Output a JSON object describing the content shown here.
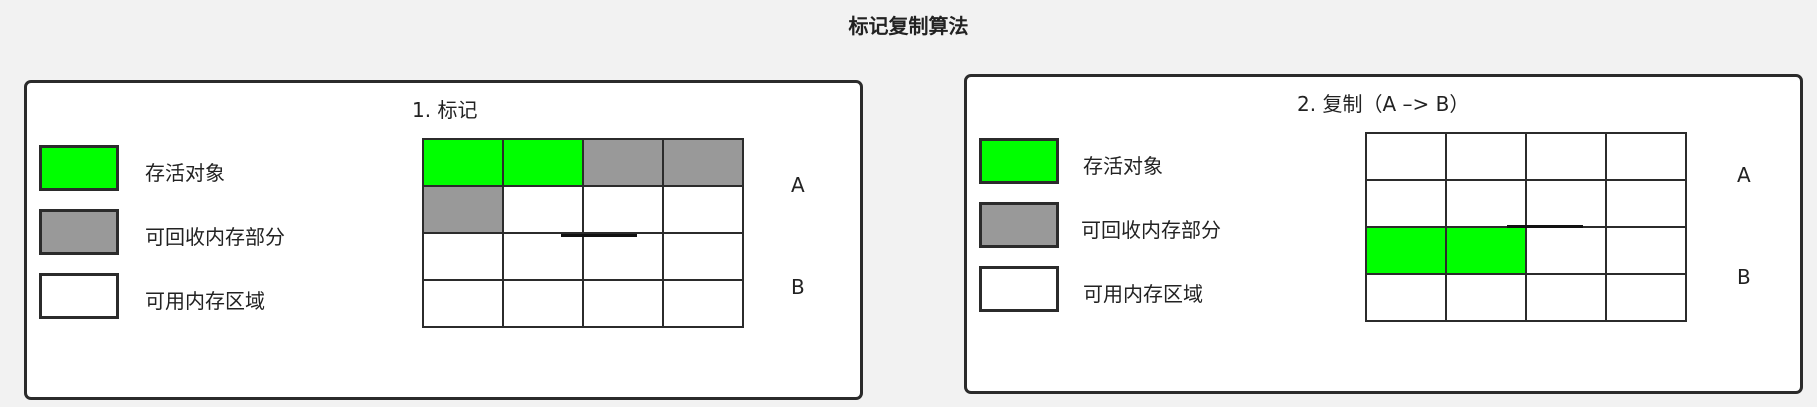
{
  "colors": {
    "live": "#00ff00",
    "reclaimable": "#999999",
    "free": "#ffffff",
    "border": "#2b2b2b",
    "background": "#f2f2f2"
  },
  "title": "标记复制算法",
  "panels": [
    {
      "title": "1. 标记",
      "legend": [
        {
          "label": "存活对象",
          "state": "live"
        },
        {
          "label": "可回收内存部分",
          "state": "reclaimable"
        },
        {
          "label": "可用内存区域",
          "state": "free"
        }
      ],
      "regions": [
        "A",
        "B"
      ],
      "cells": [
        [
          "live",
          "live",
          "reclaimable",
          "reclaimable"
        ],
        [
          "reclaimable",
          "free",
          "free",
          "free"
        ],
        [
          "free",
          "free",
          "free",
          "free"
        ],
        [
          "free",
          "free",
          "free",
          "free"
        ]
      ]
    },
    {
      "title": "2. 复制（A –> B）",
      "legend": [
        {
          "label": "存活对象",
          "state": "live"
        },
        {
          "label": "可回收内存部分",
          "state": "reclaimable"
        },
        {
          "label": "可用内存区域",
          "state": "free"
        }
      ],
      "regions": [
        "A",
        "B"
      ],
      "cells": [
        [
          "free",
          "free",
          "free",
          "free"
        ],
        [
          "free",
          "free",
          "free",
          "free"
        ],
        [
          "live",
          "live",
          "free",
          "free"
        ],
        [
          "free",
          "free",
          "free",
          "free"
        ]
      ]
    }
  ]
}
